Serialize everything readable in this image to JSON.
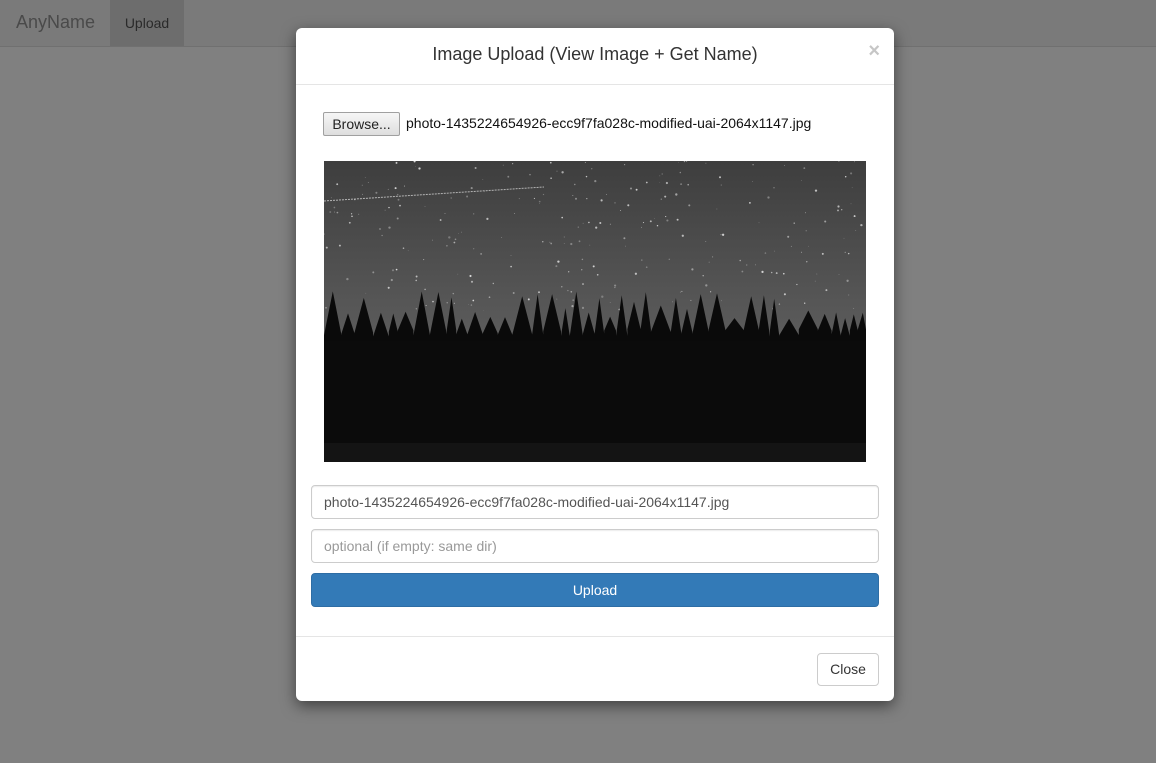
{
  "navbar": {
    "brand": "AnyName",
    "upload_label": "Upload"
  },
  "modal": {
    "title": "Image Upload (View Image + Get Name)",
    "close_symbol": "×",
    "file_picker": {
      "button_label": "Browse...",
      "selected_file": "photo-1435224654926-ecc9f7fa028c-modified-uai-2064x1147.jpg"
    },
    "name_input": {
      "value": "photo-1435224654926-ecc9f7fa028c-modified-uai-2064x1147.jpg"
    },
    "dir_input": {
      "placeholder": "optional (if empty: same dir)"
    },
    "upload_button_label": "Upload",
    "close_button_label": "Close"
  },
  "colors": {
    "primary": "#337ab7",
    "backdrop": "#808080"
  }
}
